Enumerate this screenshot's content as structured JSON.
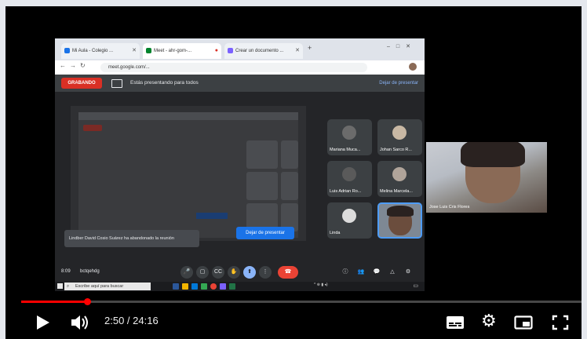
{
  "player": {
    "time": "2:50 / 24:16",
    "progress_fraction": 0.117,
    "accent": "#ff0000"
  },
  "recording": {
    "tabs": [
      {
        "label": "Mi Aula - Colegio ...",
        "color": "#1a73e8"
      },
      {
        "label": "Meet - ahr-gom-...",
        "color": "#00832d"
      },
      {
        "label": "Crear un documento ...",
        "color": "#7b61ff"
      }
    ],
    "url": "meet.google.com/...",
    "rec_badge": "GRABANDO",
    "presenting_text": "Estás presentando para todos",
    "stop_link": "Dejar de presentar",
    "participants": [
      {
        "name": "Mariana Muca..."
      },
      {
        "name": "Johan Sarco R..."
      },
      {
        "name": "Luis Adrian Ro..."
      },
      {
        "name": "Melina Marcela..."
      },
      {
        "name": "Linda"
      }
    ],
    "toast": "Lindber David Cosio Suárez ha abandonado la reunión",
    "present_button": "Dejar de presentar",
    "clock": "8:09",
    "meeting_code": "bctqehdg",
    "taskbar_search": "Escribe aquí para buscar"
  },
  "webcam": {
    "label": "Jose Luis Cris Flores"
  }
}
